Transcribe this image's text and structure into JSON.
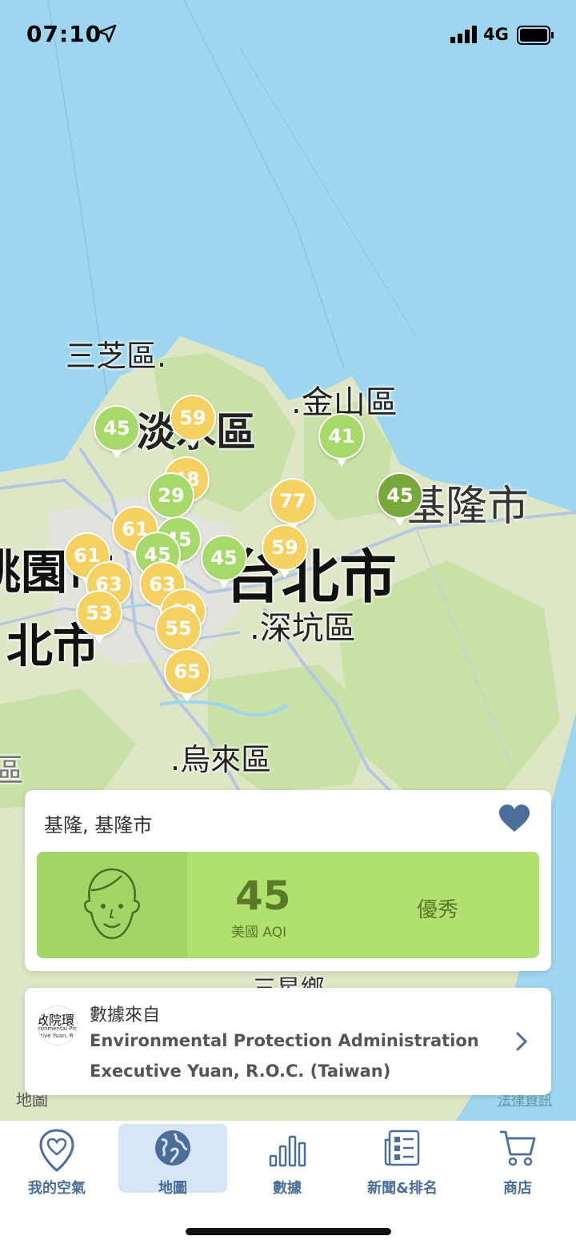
{
  "status_bar": {
    "time": "07:10",
    "network": "4G"
  },
  "map": {
    "places": {
      "sanzhi": "三芝區.",
      "tamsui": "淡水區",
      "jinshan": ".金山區",
      "keelung_city": "基隆市",
      "taipei_city": "台北市",
      "taoyuan": "桃園市",
      "new_taipei": "北市",
      "shenkeng": ".深坑區",
      "wulai": ".烏來區",
      "edge_left": "區",
      "partial_bottom": ".三星鄉"
    },
    "pins": [
      {
        "label": "45",
        "level": "good"
      },
      {
        "label": "59",
        "level": "moderate"
      },
      {
        "label": "41",
        "level": "good"
      },
      {
        "label": "48",
        "level": "moderate"
      },
      {
        "label": "29",
        "level": "good"
      },
      {
        "label": "77",
        "level": "moderate"
      },
      {
        "label": "45",
        "level": "good-selected"
      },
      {
        "label": "61",
        "level": "moderate"
      },
      {
        "label": "45",
        "level": "good"
      },
      {
        "label": "45",
        "level": "good"
      },
      {
        "label": "61",
        "level": "moderate"
      },
      {
        "label": "45",
        "level": "good"
      },
      {
        "label": "59",
        "level": "moderate"
      },
      {
        "label": "63",
        "level": "moderate"
      },
      {
        "label": "63",
        "level": "moderate"
      },
      {
        "label": "53",
        "level": "moderate"
      },
      {
        "label": "60",
        "level": "moderate"
      },
      {
        "label": "55",
        "level": "moderate"
      },
      {
        "label": "65",
        "level": "moderate"
      }
    ],
    "maps_logo": "地圖",
    "legal": "法律資訊"
  },
  "station_card": {
    "city": "基隆, 基隆市",
    "aqi_value": "45",
    "aqi_unit": "美國 AQI",
    "level": "優秀"
  },
  "source_card": {
    "logo_line1": "政院環",
    "logo_line2": "ironmental Prote",
    "logo_line3": "utive Yuan, R.",
    "from_label": "數據來自",
    "org_line1": "Environmental Protection Administration",
    "org_line2": "Executive Yuan, R.O.C. (Taiwan)"
  },
  "tabs": [
    {
      "label": "我的空氣"
    },
    {
      "label": "地圖"
    },
    {
      "label": "數據"
    },
    {
      "label": "新聞&排名"
    },
    {
      "label": "商店"
    }
  ],
  "colors": {
    "good": "#a6d96a",
    "moderate": "#f4d160",
    "selected": "#78a83c",
    "tab_active": "#d6e6f6",
    "tab_text": "#4a6d9a"
  }
}
